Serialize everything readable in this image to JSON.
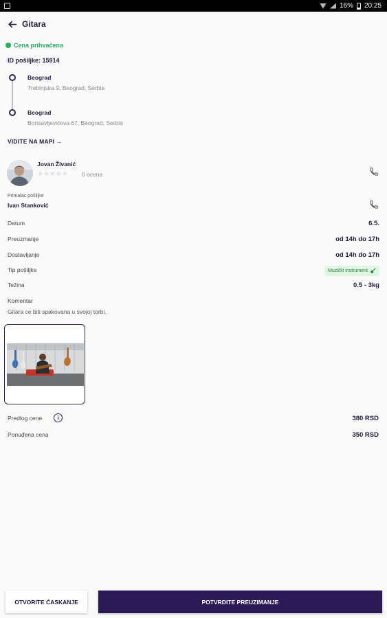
{
  "statusbar": {
    "battery": "16%",
    "time": "20:25"
  },
  "appbar": {
    "title": "Gitara"
  },
  "shipment": {
    "status": "Cena prihvaćena",
    "id_label": "ID pošiljke: 15914",
    "pickup": {
      "city": "Beograd",
      "address": "Trebinjska 9, Beograd, Serbia"
    },
    "dropoff": {
      "city": "Beograd",
      "address": "Borisavljevićeva 67, Beograd, Serbia"
    },
    "map_link": "VIDITE NA MAPI →"
  },
  "driver": {
    "name": "Jovan Živanić",
    "rating_text": "0 ocena",
    "stars": "★★★★★"
  },
  "receiver": {
    "label": "Primalac pošiljke",
    "name": "Ivan Stanković"
  },
  "details": [
    {
      "label": "Datum",
      "value": "6.5."
    },
    {
      "label": "Preuzmanje",
      "value": "od 14h do 17h"
    },
    {
      "label": "Dostavljanje",
      "value": "od 14h do 17h"
    },
    {
      "label": "Tip pošiljke",
      "value": "Muzički instrument"
    },
    {
      "label": "Težina",
      "value": "0.5 - 3kg"
    }
  ],
  "comment": {
    "label": "Komentar",
    "text": "Gitara ce biti spakovana u svojoj torbi."
  },
  "prices": {
    "suggested_label": "Predlog cene",
    "suggested_value": "380 RSD",
    "offered_label": "Ponuđena cena",
    "offered_value": "350 RSD"
  },
  "actions": {
    "chat": "OTVORITE ĆASKANJE",
    "confirm": "POTVRDITE PREUZIMANJE"
  }
}
